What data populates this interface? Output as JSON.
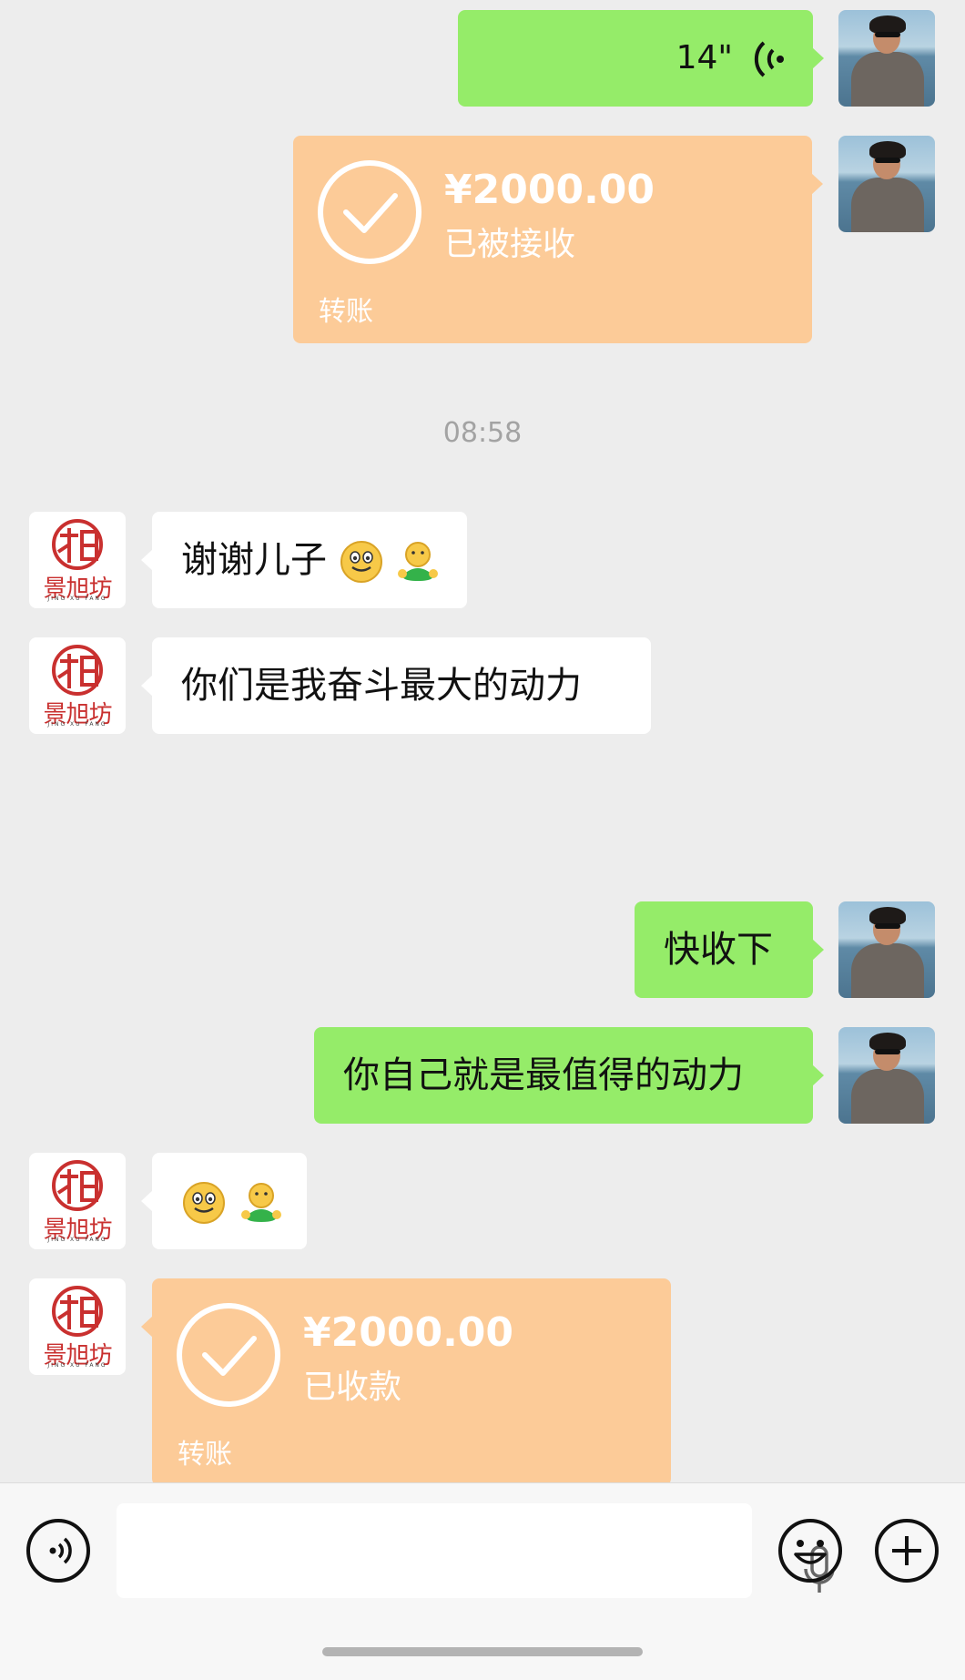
{
  "messages": {
    "voice_duration": "14\"",
    "transfer_sent": {
      "amount": "¥2000.00",
      "status": "已被接收",
      "label": "转账"
    },
    "timestamp": "08:58",
    "msg_thanks": "谢谢儿子",
    "msg_motivation": "你们是我奋斗最大的动力",
    "msg_accept": "快收下",
    "msg_yourself": "你自己就是最值得的动力",
    "transfer_received": {
      "amount": "¥2000.00",
      "status": "已收款",
      "label": "转账"
    }
  },
  "avatar_logo": {
    "title": "景旭坊",
    "subtitle": "JING XU FANG"
  },
  "colors": {
    "background": "#ededed",
    "bubble_green": "#95ec69",
    "bubble_white": "#ffffff",
    "transfer_orange": "#fccb98",
    "seal_red": "#c9302f"
  },
  "input_bar": {
    "icons": [
      "voice-mode-icon",
      "microphone-icon",
      "emoji-icon",
      "plus-icon"
    ]
  }
}
